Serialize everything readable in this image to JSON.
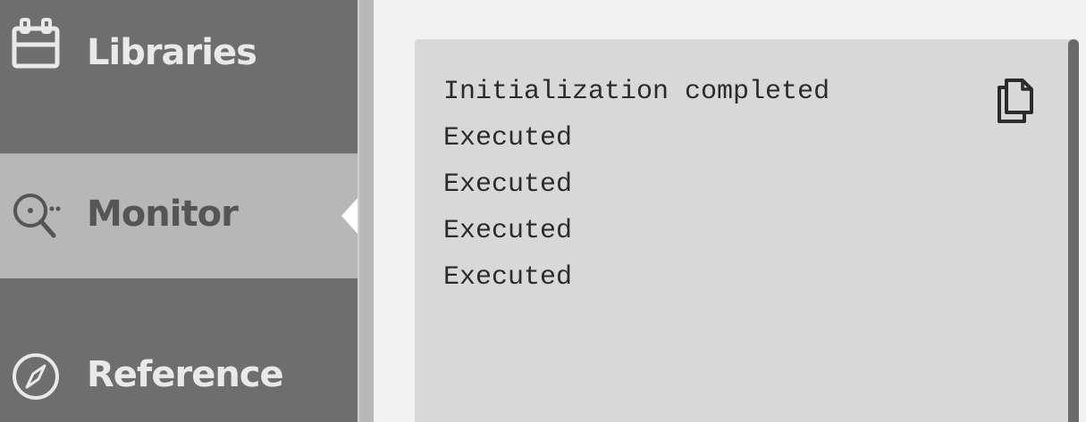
{
  "sidebar": {
    "items": [
      {
        "label": "Libraries",
        "icon": "calendar-icon",
        "active": false
      },
      {
        "label": "Monitor",
        "icon": "monitor-search-icon",
        "active": true
      },
      {
        "label": "Reference",
        "icon": "compass-icon",
        "active": false
      }
    ]
  },
  "console": {
    "lines": [
      "Initialization completed",
      "Executed",
      "Executed",
      "Executed",
      "Executed"
    ],
    "copy_icon": "copy-icon"
  },
  "colors": {
    "sidebar_bg": "#6e6e6e",
    "active_item_bg": "#b7b7b7",
    "console_bg": "#d8d8d8",
    "page_bg": "#f2f2f2"
  }
}
